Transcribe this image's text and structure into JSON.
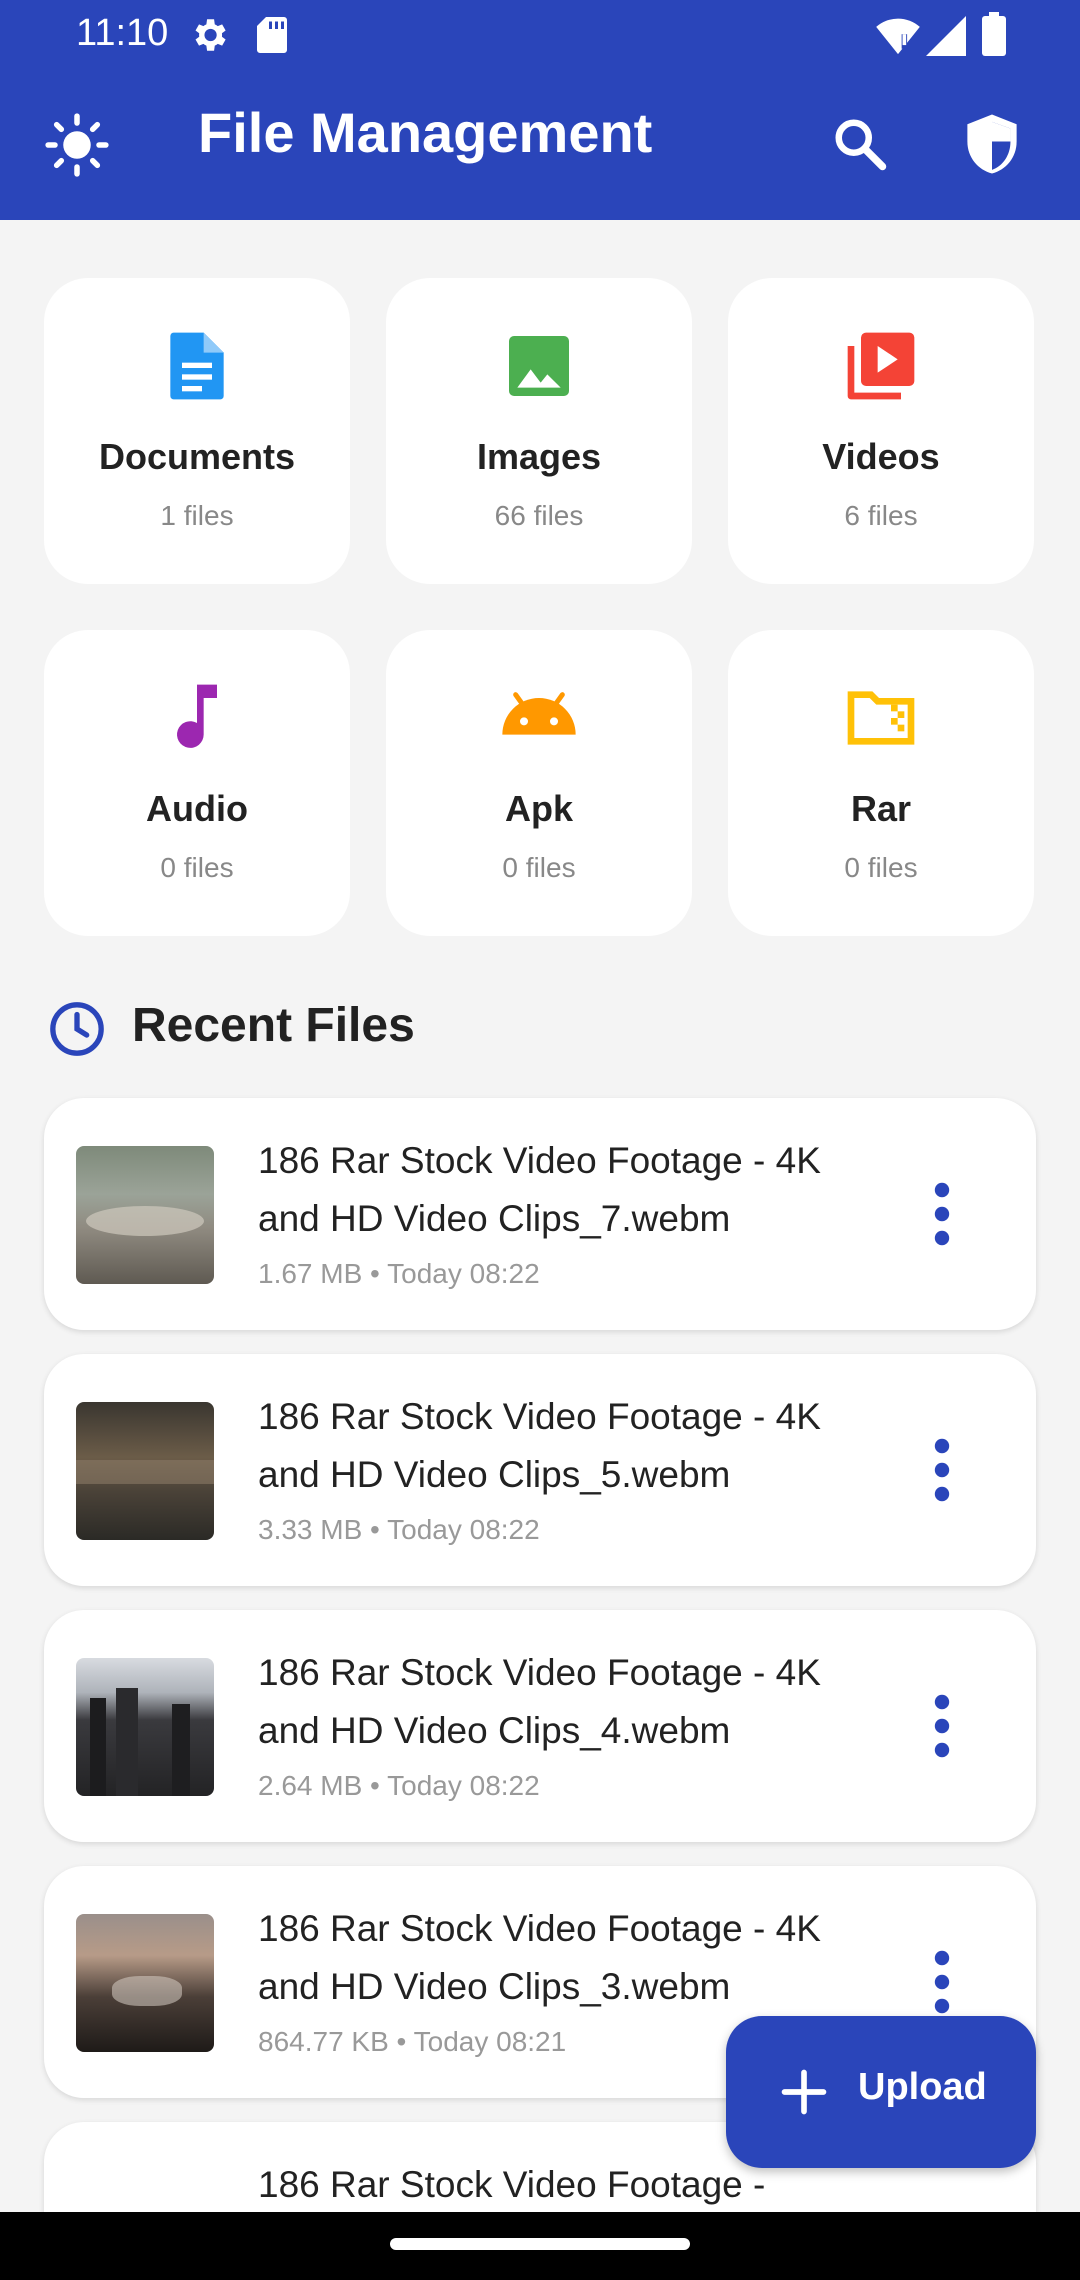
{
  "status_bar": {
    "time": "11:10"
  },
  "app_bar": {
    "title": "File Management"
  },
  "categories": [
    {
      "name": "Documents",
      "count": "1 files",
      "icon": "document-icon",
      "color": "#2196f3"
    },
    {
      "name": "Images",
      "count": "66 files",
      "icon": "image-icon",
      "color": "#4caf50"
    },
    {
      "name": "Videos",
      "count": "6 files",
      "icon": "video-library-icon",
      "color": "#f44336"
    },
    {
      "name": "Audio",
      "count": "0 files",
      "icon": "music-note-icon",
      "color": "#9c27b0"
    },
    {
      "name": "Apk",
      "count": "0 files",
      "icon": "android-icon",
      "color": "#ff9800"
    },
    {
      "name": "Rar",
      "count": "0 files",
      "icon": "zip-folder-icon",
      "color": "#ffc107"
    }
  ],
  "recent": {
    "title": "Recent Files",
    "files": [
      {
        "name": "186 Rar Stock Video Footage - 4K and HD Video Clips_7.webm",
        "meta": "1.67 MB • Today 08:22"
      },
      {
        "name": "186 Rar Stock Video Footage - 4K and HD Video Clips_5.webm",
        "meta": "3.33 MB • Today 08:22"
      },
      {
        "name": "186 Rar Stock Video Footage - 4K and HD Video Clips_4.webm",
        "meta": "2.64 MB • Today 08:22"
      },
      {
        "name": "186 Rar Stock Video Footage - 4K and HD Video Clips_3.webm",
        "meta": "864.77 KB • Today 08:21"
      },
      {
        "name": "186 Rar Stock Video Footage -",
        "meta": ""
      }
    ]
  },
  "fab": {
    "label": "Upload"
  },
  "colors": {
    "primary": "#2a45ba",
    "background": "#f4f4f4",
    "accent_icon": "#2a45ba"
  }
}
